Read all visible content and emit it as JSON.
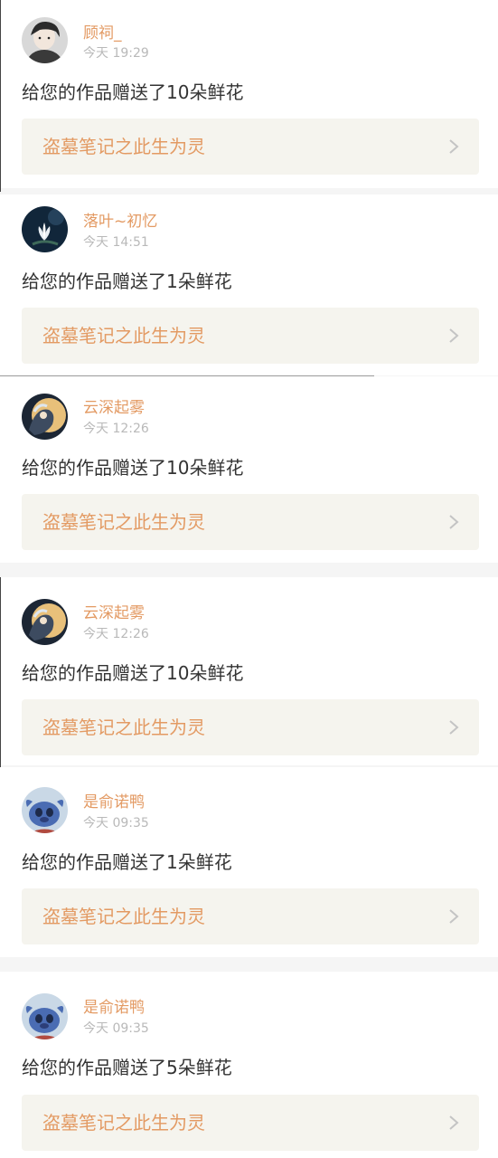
{
  "notifications": [
    {
      "username": "顾祠_",
      "time": "今天 19:29",
      "message": "给您的作品赠送了10朵鲜花",
      "work_title": "盗墓笔记之此生为灵",
      "avatar_icon": "avatar-boy-portrait"
    },
    {
      "username": "落叶~初忆",
      "time": "今天 14:51",
      "message": "给您的作品赠送了1朵鲜花",
      "work_title": "盗墓笔记之此生为灵",
      "avatar_icon": "avatar-lotus"
    },
    {
      "username": "云深起雾",
      "time": "今天 12:26",
      "message": "给您的作品赠送了10朵鲜花",
      "work_title": "盗墓笔记之此生为灵",
      "avatar_icon": "avatar-moon-figure"
    },
    {
      "username": "云深起雾",
      "time": "今天 12:26",
      "message": "给您的作品赠送了10朵鲜花",
      "work_title": "盗墓笔记之此生为灵",
      "avatar_icon": "avatar-moon-figure"
    },
    {
      "username": "是俞诺鸭",
      "time": "今天 09:35",
      "message": "给您的作品赠送了1朵鲜花",
      "work_title": "盗墓笔记之此生为灵",
      "avatar_icon": "avatar-stitch"
    },
    {
      "username": "是俞诺鸭",
      "time": "今天 09:35",
      "message": "给您的作品赠送了5朵鲜花",
      "work_title": "盗墓笔记之此生为灵",
      "avatar_icon": "avatar-stitch"
    }
  ],
  "colors": {
    "accent": "#e39a63",
    "text": "#333333",
    "muted": "#b9b9b9",
    "link_bg": "#f5f4ee",
    "page_bg": "#f5f5f5"
  }
}
